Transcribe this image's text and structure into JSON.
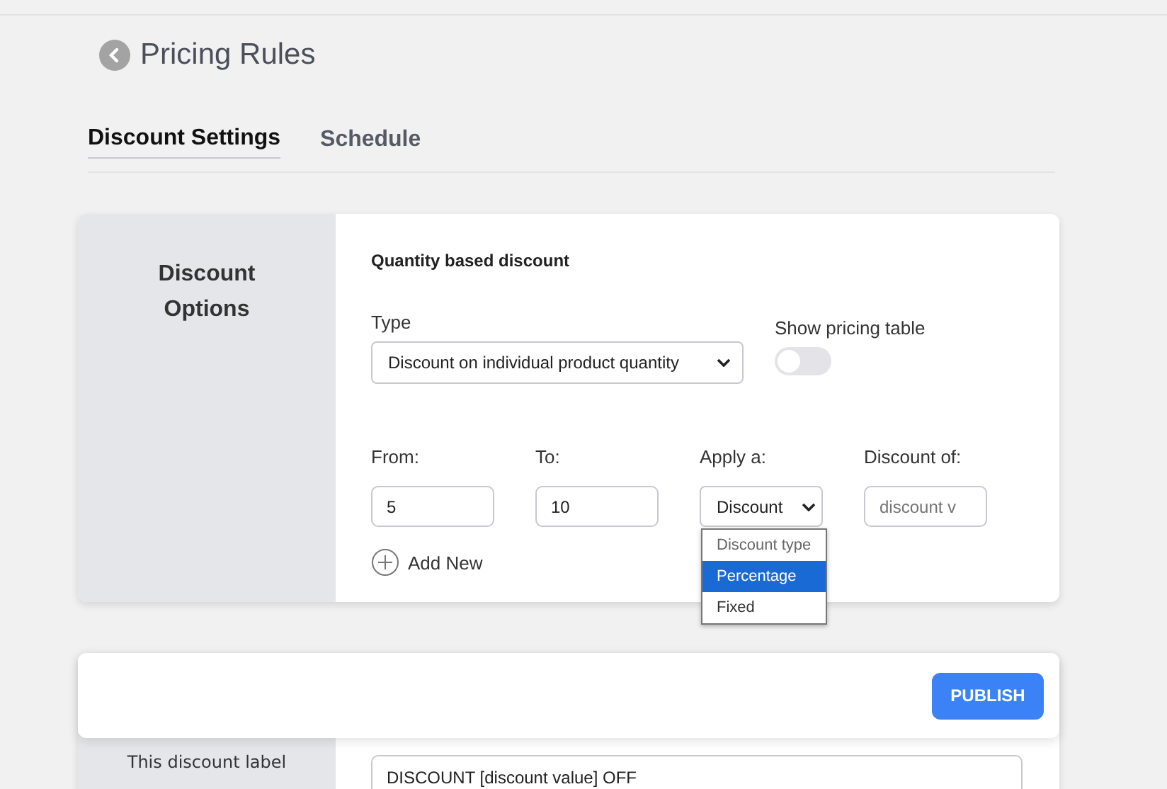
{
  "page": {
    "title": "Pricing Rules"
  },
  "tabs": [
    {
      "label": "Discount Settings",
      "selected": true
    },
    {
      "label": "Schedule",
      "selected": false
    }
  ],
  "discount_options": {
    "heading": "Discount Options",
    "section_title": "Quantity based discount",
    "type_label": "Type",
    "type_value": "Discount on individual product quantity",
    "toggle_label": "Show pricing table",
    "toggle_on": false,
    "columns": [
      {
        "label": "From:",
        "kind": "input",
        "value": "5"
      },
      {
        "label": "To:",
        "kind": "input",
        "value": "10"
      },
      {
        "label": "Apply a:",
        "kind": "select",
        "value": "Discount"
      },
      {
        "label": "Discount of:",
        "kind": "input",
        "placeholder": "discount v"
      }
    ],
    "add_new": "Add New",
    "dropdown": [
      {
        "label": "Discount type",
        "selected": false
      },
      {
        "label": "Percentage",
        "selected": true
      },
      {
        "label": "Fixed",
        "selected": false
      }
    ]
  },
  "publish_button": "PUBLISH",
  "label_section": {
    "description": "This discount label",
    "value": "DISCOUNT [discount value] OFF"
  }
}
